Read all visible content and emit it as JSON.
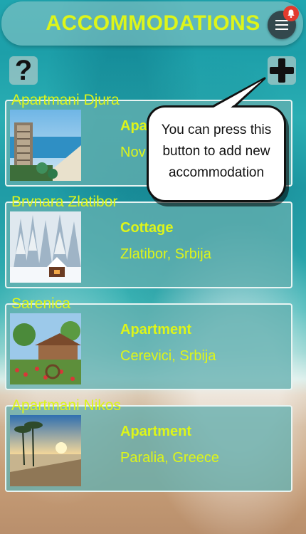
{
  "header": {
    "title": "ACCOMMODATIONS",
    "menu_icon": "hamburger-menu-icon",
    "notification_icon": "bell-icon"
  },
  "toolbar": {
    "help_label": "?",
    "add_icon": "plus-icon"
  },
  "tooltip": {
    "text": "You can press this button to add new accommodation"
  },
  "accommodations": [
    {
      "name": "Apartmani Djura",
      "type": "Apa",
      "location": "Nov"
    },
    {
      "name": "Brvnara Zlatibor",
      "type": "Cottage",
      "location": "Zlatibor, Srbija"
    },
    {
      "name": "Sarenica",
      "type": "Apartment",
      "location": "Cerevici, Srbija"
    },
    {
      "name": "Apartmani Nikos",
      "type": "Apartment",
      "location": "Paralia, Greece"
    }
  ],
  "colors": {
    "accent": "#ddf51a",
    "badge": "#e23b2e",
    "menu_button": "#33484d"
  }
}
